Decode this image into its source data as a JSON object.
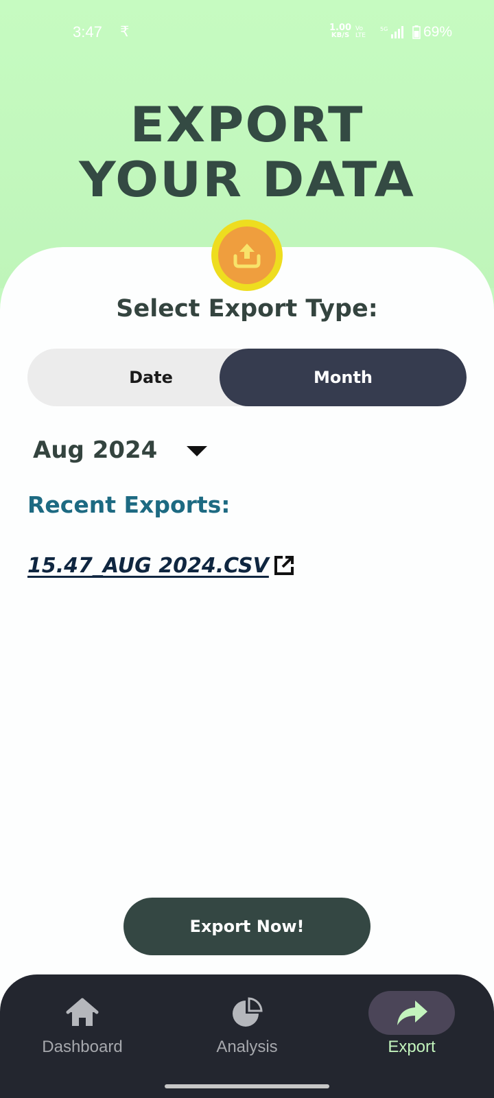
{
  "status_bar": {
    "time": "3:47",
    "currency_symbol": "₹",
    "net_speed_value": "1.00",
    "net_speed_unit": "KB/S",
    "volte_top": "Vo",
    "volte_bottom": "LTE",
    "signal_label": "5G",
    "battery": "69%"
  },
  "header": {
    "title_line1": "EXPORT",
    "title_line2": "YOUR DATA",
    "icon": "upload-tray-icon"
  },
  "export_type": {
    "label": "Select Export Type:",
    "options": [
      "Date",
      "Month"
    ],
    "selected": "Month"
  },
  "period_select": {
    "value": "Aug 2024"
  },
  "recent_exports": {
    "heading": "Recent Exports:",
    "items": [
      {
        "filename": "15.47_AUG 2024.CSV",
        "icon": "open-external-icon"
      }
    ]
  },
  "actions": {
    "export_label": "Export Now!"
  },
  "bottom_nav": {
    "items": [
      {
        "label": "Dashboard",
        "icon": "home-icon"
      },
      {
        "label": "Analysis",
        "icon": "pie-chart-icon"
      },
      {
        "label": "Export",
        "icon": "share-arrow-icon",
        "active": true
      }
    ]
  },
  "colors": {
    "header_bg": "#c3f8bf",
    "title": "#344a43",
    "toggle_active": "#363c4f",
    "recent_heading": "#1d6a82",
    "export_button": "#344743",
    "nav_bg": "#23262f",
    "nav_active_label": "#c3f4bd",
    "badge_ring": "#eedd1f",
    "badge_fill": "#ef9e3e"
  }
}
